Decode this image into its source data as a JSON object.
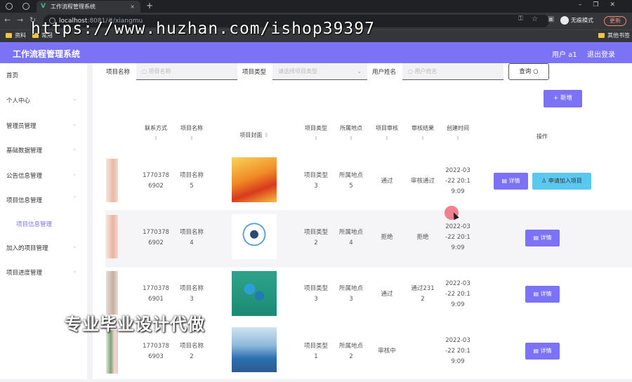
{
  "browser": {
    "tab_title": "工作流程管理系统",
    "url_host": "localhost",
    "url_rest": ":8081/#/xiangmu",
    "incognito": "无痕模式",
    "update": "更新",
    "bookmarks": [
      "资料",
      "常用"
    ],
    "other_bookmarks": "其他书签"
  },
  "watermark": {
    "url": "https://www.huzhan.com/ishop39397",
    "caption": "专业毕业设计代做"
  },
  "app": {
    "title": "工作流程管理系统",
    "user": "用户 a1",
    "logout": "退出登录"
  },
  "sidebar": {
    "items": [
      {
        "label": "首页"
      },
      {
        "label": "个人中心"
      },
      {
        "label": "管理员管理"
      },
      {
        "label": "基础数据管理"
      },
      {
        "label": "公告信息管理"
      },
      {
        "label": "项目信息管理"
      },
      {
        "label": "项目信息管理"
      },
      {
        "label": "加入的项目管理"
      },
      {
        "label": "项目进度管理"
      }
    ]
  },
  "filters": {
    "name_label": "项目名称",
    "name_placeholder": "项目名称",
    "type_label": "项目类型",
    "type_placeholder": "请选择项目类型",
    "user_label": "用户姓名",
    "user_placeholder": "用户姓名",
    "query": "查询",
    "add": "+ 新增"
  },
  "table": {
    "columns": [
      "联系方式",
      "项目名称",
      "项目封面",
      "项目类型",
      "所属地点",
      "项目审核",
      "审核结果",
      "创建时间",
      "操作"
    ],
    "rows": [
      {
        "phone1": "1770378",
        "phone2": "6902",
        "name1": "项目名称",
        "name2": "5",
        "type1": "项目类型",
        "type2": "3",
        "loc1": "所属地点",
        "loc2": "5",
        "audit": "通过",
        "result": "审核通过",
        "t1": "2022-03",
        "t2": "-22 20:1",
        "t3": "9:09",
        "detail": "详情",
        "apply": "申请加入项目"
      },
      {
        "phone1": "1770378",
        "phone2": "6902",
        "name1": "项目名称",
        "name2": "4",
        "type1": "项目类型",
        "type2": "2",
        "loc1": "所属地点",
        "loc2": "4",
        "audit": "拒绝",
        "result": "拒绝",
        "t1": "2022-03",
        "t2": "-22 20:1",
        "t3": "9:09",
        "detail": "详情"
      },
      {
        "phone1": "1770378",
        "phone2": "6901",
        "name1": "项目名称",
        "name2": "3",
        "type1": "项目类型",
        "type2": "3",
        "loc1": "所属地点",
        "loc2": "3",
        "audit": "通过",
        "result1": "通过231",
        "result2": "2",
        "t1": "2022-03",
        "t2": "-22 20:1",
        "t3": "9:09",
        "detail": "详情"
      },
      {
        "phone1": "1770378",
        "phone2": "6903",
        "name1": "项目名称",
        "name2": "2",
        "type1": "项目类型",
        "type2": "1",
        "loc1": "所属地点",
        "loc2": "2",
        "audit": "审核中",
        "result": "",
        "t1": "2022-03",
        "t2": "-22 20:1",
        "t3": "9:09",
        "detail": "详情"
      }
    ]
  },
  "colors": {
    "primary": "#7b72f6",
    "apply": "#5bc8f0"
  }
}
